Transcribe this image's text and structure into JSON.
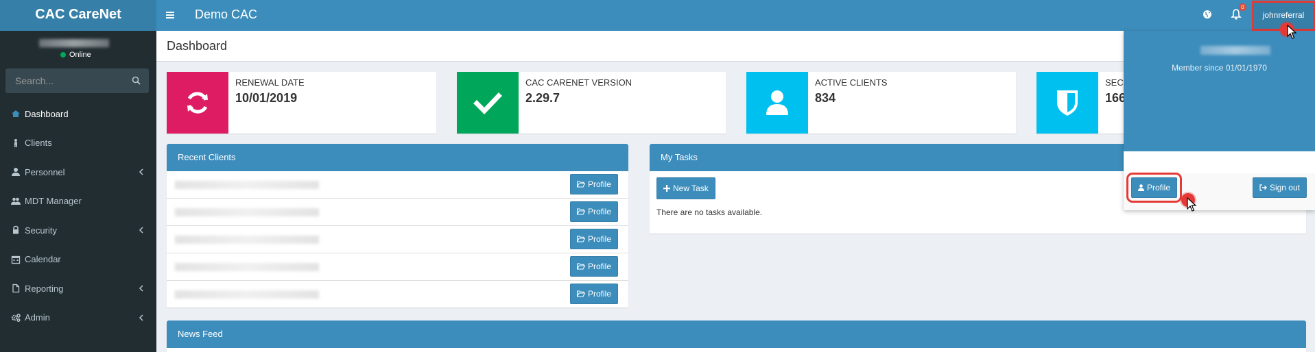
{
  "app": {
    "logo": "CAC CareNet",
    "title": "Demo CAC",
    "menu_icon": "hamburger-icon"
  },
  "topbar": {
    "notifications_count": "0",
    "username": "johnreferral"
  },
  "sidebar": {
    "status": "Online",
    "search_placeholder": "Search...",
    "items": [
      {
        "label": "Dashboard",
        "icon": "dashboard-icon",
        "has_submenu": false
      },
      {
        "label": "Clients",
        "icon": "child-icon",
        "has_submenu": false
      },
      {
        "label": "Personnel",
        "icon": "user-icon",
        "has_submenu": true
      },
      {
        "label": "MDT Manager",
        "icon": "users-icon",
        "has_submenu": false
      },
      {
        "label": "Security",
        "icon": "lock-icon",
        "has_submenu": true
      },
      {
        "label": "Calendar",
        "icon": "calendar-icon",
        "has_submenu": false
      },
      {
        "label": "Reporting",
        "icon": "file-icon",
        "has_submenu": true
      },
      {
        "label": "Admin",
        "icon": "cogs-icon",
        "has_submenu": true
      }
    ]
  },
  "page": {
    "title": "Dashboard"
  },
  "info_boxes": [
    {
      "label": "RENEWAL DATE",
      "value": "10/01/2019",
      "color": "#dd1c64",
      "icon": "refresh-icon"
    },
    {
      "label": "CAC CARENET VERSION",
      "value": "2.29.7",
      "color": "#00a65a",
      "icon": "check-icon"
    },
    {
      "label": "ACTIVE CLIENTS",
      "value": "834",
      "color": "#00c0ef",
      "icon": "user-icon"
    },
    {
      "label": "SEC",
      "value": "166",
      "color": "#00c0ef",
      "icon": "shield-icon"
    }
  ],
  "recent_clients": {
    "title": "Recent Clients",
    "button_label": "Profile",
    "rows": 5
  },
  "my_tasks": {
    "title": "My Tasks",
    "new_task_label": "New Task",
    "empty_text": "There are no tasks available."
  },
  "news_feed": {
    "title": "News Feed"
  },
  "user_dropdown": {
    "member_since": "Member since 01/01/1970",
    "profile_label": "Profile",
    "signout_label": "Sign out"
  },
  "colors": {
    "primary": "#3c8dbc",
    "sidebar": "#222d32",
    "highlight": "#e53935"
  }
}
